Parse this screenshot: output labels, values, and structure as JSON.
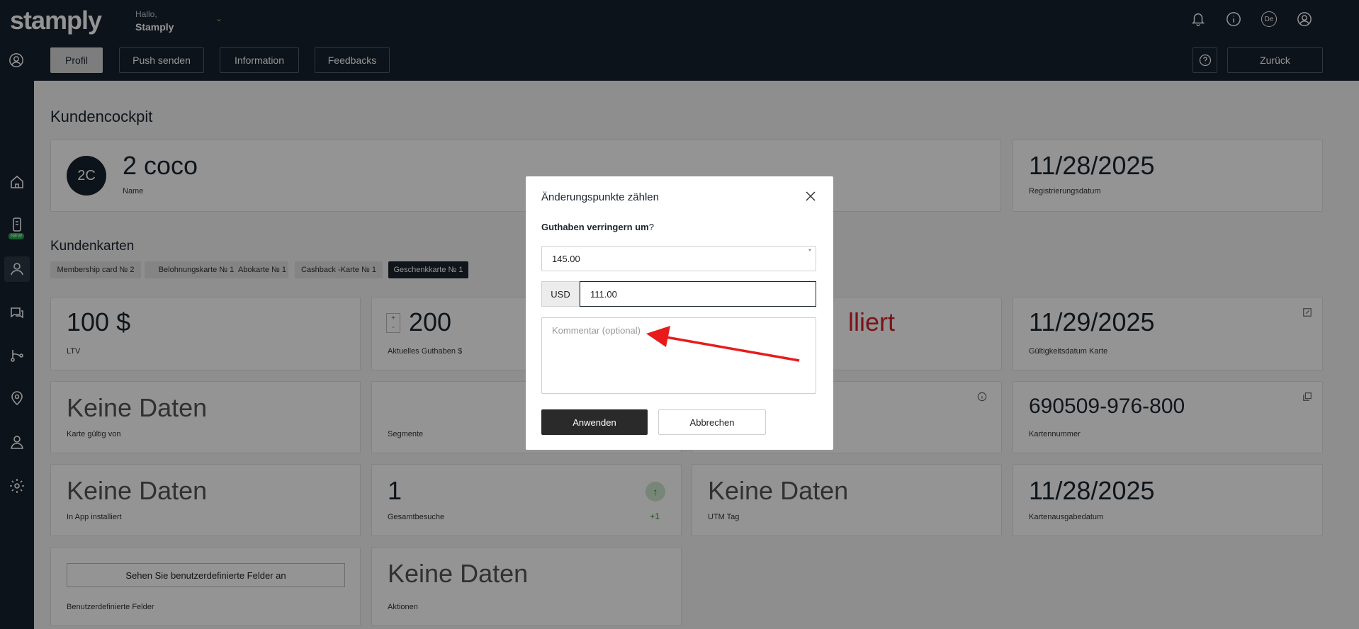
{
  "header": {
    "logo": "stamply",
    "greeting": "Hallo,",
    "username": "Stamply",
    "language_badge": "De"
  },
  "nav": {
    "tabs": [
      "Profil",
      "Push senden",
      "Information",
      "Feedbacks"
    ],
    "back": "Zurück"
  },
  "sidebar": {
    "new_badge": "NEW"
  },
  "page": {
    "title": "Kundencockpit",
    "customer": {
      "avatar_initials": "2C",
      "name": "2 coco",
      "name_label": "Name",
      "reg_date": "11/28/2025",
      "reg_label": "Registrierungsdatum"
    },
    "cards_title": "Kundenkarten",
    "chips": [
      "Membership card № 2",
      "Belohnungskarte № 1",
      "Abokarte № 1",
      "Cashback -Karte № 1",
      "Geschenkkarte № 1"
    ],
    "tiles": {
      "ltv": {
        "value": "100 $",
        "label": "LTV"
      },
      "balance": {
        "value": "200",
        "label": "Aktuelles Guthaben $"
      },
      "status": {
        "value": "lliert"
      },
      "valid_date": {
        "value": "11/29/2025",
        "label": "Gültigkeitsdatum Karte"
      },
      "valid_from": {
        "value": "Keine Daten",
        "label": "Karte gültig von"
      },
      "segments": {
        "label": "Segmente"
      },
      "card_number": {
        "value": "690509-976-800",
        "label": "Kartennummer"
      },
      "in_app": {
        "value": "Keine Daten",
        "label": "In App installiert"
      },
      "visits": {
        "value": "1",
        "label": "Gesamtbesuche",
        "delta": "+1"
      },
      "utm": {
        "value": "Keine Daten",
        "label": "UTM Tag"
      },
      "issue_date": {
        "value": "11/28/2025",
        "label": "Kartenausgabedatum"
      },
      "custom_fields": {
        "button": "Sehen Sie benutzerdefinierte Felder an",
        "label": "Benutzerdefinierte Felder"
      },
      "actions": {
        "value": "Keine Daten",
        "label": "Aktionen"
      }
    }
  },
  "modal": {
    "title": "Änderungspunkte zählen",
    "question_bold": "Guthaben verringern um",
    "question_mark": "?",
    "points_value": "145.00",
    "required_mark": "*",
    "currency": "USD",
    "amount_value": "111.00",
    "comment_placeholder": "Kommentar (optional)",
    "apply": "Anwenden",
    "cancel": "Abbrechen"
  },
  "colors": {
    "dark": "#18222e",
    "accent_red": "#d2222c",
    "arrow_red": "#e81b1b",
    "new_badge": "#1fa84a"
  }
}
